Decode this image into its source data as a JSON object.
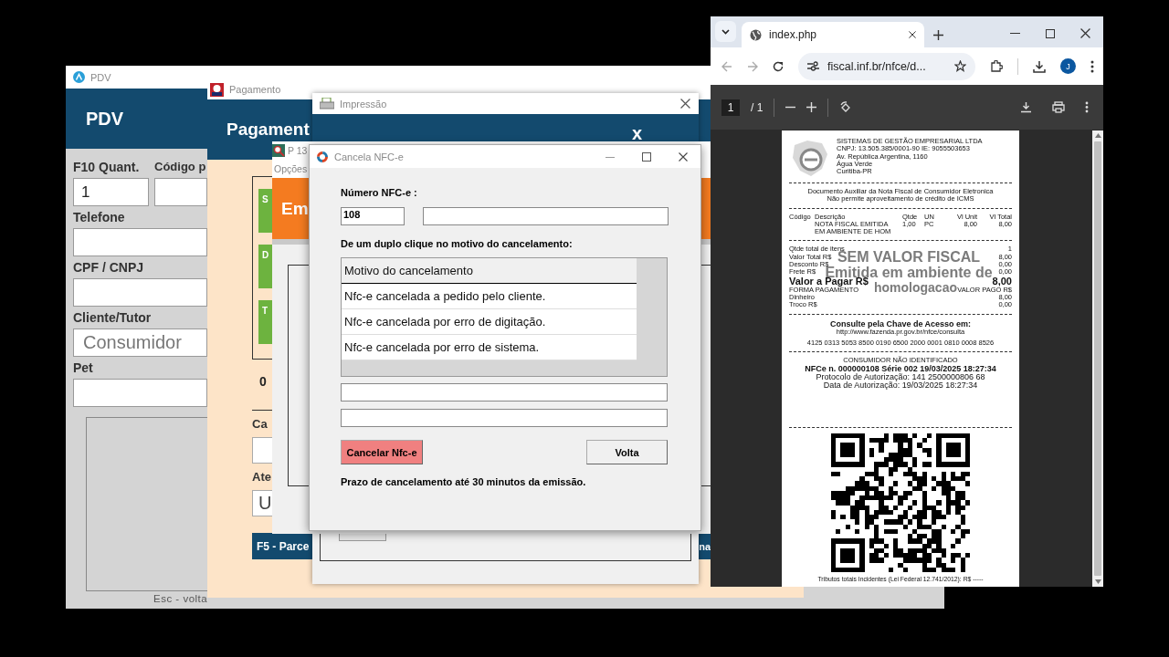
{
  "pdv_window": {
    "title": "PDV",
    "header": "PDV",
    "fields": [
      {
        "label": "F10 Quant.",
        "value": "1"
      },
      {
        "label": "Código p"
      },
      {
        "label": "Telefone"
      },
      {
        "label": "CPF / CNPJ"
      },
      {
        "label": "Cliente/Tutor",
        "placeholder": "Consumidor"
      },
      {
        "label": "Pet"
      }
    ],
    "footer": "Esc - volta"
  },
  "payment_window": {
    "title": "Pagamento",
    "header": "Pagament",
    "option_tiles": [
      "S",
      "D",
      "T"
    ],
    "count": "0",
    "fields": [
      {
        "label": "Ca"
      },
      {
        "label": "Ate",
        "value": "U"
      }
    ],
    "footer_buttons": [
      "F5 - Parce",
      "na"
    ]
  },
  "print_window": {
    "title": "Impressão",
    "header_close": "x"
  },
  "p135_window": {
    "title": "P 13",
    "menu": [
      "Opções"
    ],
    "header": "Em"
  },
  "cancel_dialog": {
    "title": "Cancela NFC-e",
    "number_label": "Número NFC-e :",
    "number": "108",
    "instruction": "De um duplo clique no motivo do cancelamento:",
    "reasons": {
      "header": "Motivo do cancelamento",
      "rows": [
        "Nfc-e cancelada a pedido pelo cliente.",
        "Nfc-e cancelada por erro de digitação.",
        "Nfc-e cancelada por erro de sistema."
      ]
    },
    "cancel_button": "Cancelar Nfc-e",
    "back_button": "Volta",
    "note": "Prazo de cancelamento até 30 minutos da emissão."
  },
  "browser": {
    "tab": {
      "title": "index.php",
      "selected": true
    },
    "url": "fiscal.inf.br/nfce/d...",
    "profile": "J",
    "pdf_toolbar": {
      "page": "1",
      "page_total": "/ 1"
    },
    "receipt": {
      "company": [
        "SISTEMAS DE GESTÃO EMPRESARIAL LTDA",
        "CNPJ: 13.505.385/0001-90 IE: 9055503653",
        "Av. República Argentina, 1160",
        "Água Verde",
        "Curitiba-PR"
      ],
      "notice": [
        "Documento Auxiliar da Nota Fiscal de Consumidor Eletronica",
        "Não permite aproveitamento de crédito de ICMS"
      ],
      "items_header": [
        "Código",
        "Descrição",
        "Qtde",
        "UN",
        "Vl Unit",
        "Vl Total"
      ],
      "items": [
        {
          "description": [
            "NOTA FISCAL EMITIDA",
            "EM AMBIENTE DE HOM"
          ],
          "qty": "1,00",
          "unit": "PC",
          "unit_price": "8,00",
          "total": "8,00"
        }
      ],
      "totals": [
        {
          "kind": "normal",
          "label": "Qtde total de itens",
          "value": "1"
        },
        {
          "kind": "normal",
          "label": "Valor Total R$",
          "value": "8,00"
        },
        {
          "kind": "normal",
          "label": "Desconto R$",
          "value": "0,00"
        },
        {
          "kind": "normal",
          "label": "Frete R$",
          "value": "0,00"
        },
        {
          "kind": "strong",
          "label": "Valor a Pagar R$",
          "value": "8,00"
        },
        {
          "kind": "heading",
          "label": "FORMA PAGAMENTO",
          "value": "VALOR PAGO R$"
        },
        {
          "kind": "normal",
          "label": "Dinheiro",
          "value": "8,00"
        },
        {
          "kind": "normal",
          "label": "Troco R$",
          "value": "0,00"
        }
      ],
      "watermark": [
        "SEM VALOR FISCAL",
        "Emitida em ambiente de",
        "homologacao"
      ],
      "consult": {
        "title": "Consulte pela Chave de Acesso em:",
        "url": "http://www.fazenda.pr.gov.br/nfce/consulta",
        "key": "4125 0313 5053 8500 0190 6500 2000 0001 0810 0008 8526"
      },
      "consumer": "CONSUMIDOR NÃO IDENTIFICADO",
      "nfce_line": "NFCe n. 000000108 Série 002 19/03/2025 18:27:34",
      "protocol": "Protocolo de Autorização: 141 2500000806 68",
      "auth_date": "Data de Autorização: 19/03/2025 18:27:34",
      "taxes": "Tributos totais Incidentes (Lei Federal 12.741/2012): R$ -----"
    }
  }
}
